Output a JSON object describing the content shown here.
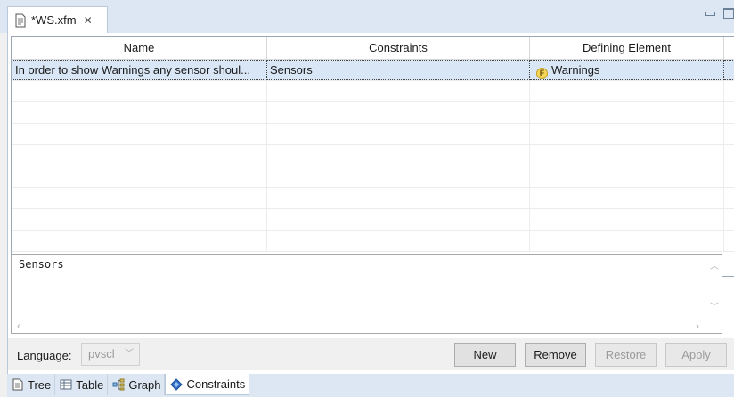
{
  "editor": {
    "tab_title": "*WS.xfm",
    "tab_close_icon": "close-icon"
  },
  "table": {
    "columns": [
      "Name",
      "Constraints",
      "Defining Element"
    ],
    "rows": [
      {
        "name": "In order to show Warnings any sensor shoul...",
        "constraints": "Sensors",
        "defining_element": "Warnings",
        "defining_badge": "F"
      }
    ]
  },
  "expression_editor": {
    "text": "Sensors"
  },
  "controls": {
    "language_label": "Language:",
    "language_value": "pvscl",
    "new_label": "New",
    "remove_label": "Remove",
    "restore_label": "Restore",
    "apply_label": "Apply"
  },
  "view_tabs": [
    {
      "label": "Tree",
      "icon": "tree-icon"
    },
    {
      "label": "Table",
      "icon": "table-icon"
    },
    {
      "label": "Graph",
      "icon": "graph-icon"
    },
    {
      "label": "Constraints",
      "icon": "constraints-icon",
      "active": true
    }
  ],
  "colors": {
    "tab_bar": "#dde7f3",
    "selection": "#d9e6f5",
    "feature_badge": "#f5d65a"
  }
}
